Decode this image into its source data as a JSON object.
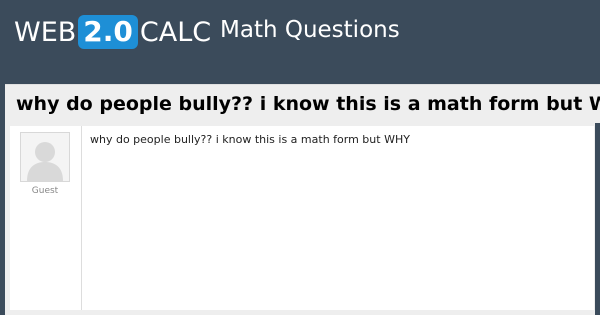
{
  "header": {
    "logo_prefix": "WEB",
    "logo_badge": "2.0",
    "logo_suffix": "CALC",
    "nav_title": "Math Questions"
  },
  "question": {
    "title": "why do people bully?? i know this is a math form but WHY"
  },
  "post": {
    "username": "Guest",
    "avatar_icon": "default-user-avatar-icon",
    "body": "why do people bully?? i know this is a math form but WHY"
  },
  "colors": {
    "header_bg": "#3b4b5b",
    "logo_badge_bg": "#1e8fd6",
    "panel_bg": "#eeeeee"
  }
}
